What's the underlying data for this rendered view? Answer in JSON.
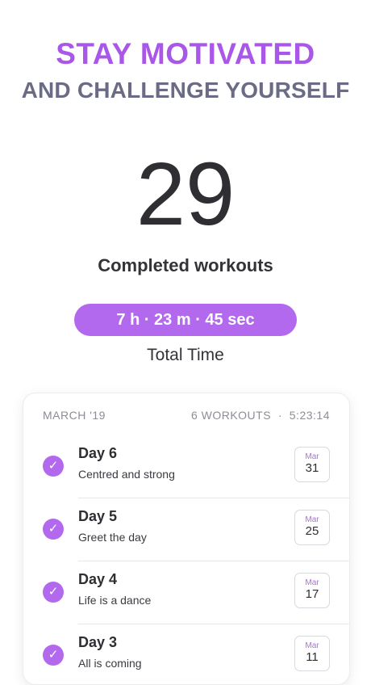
{
  "headline": {
    "line1": "STAY MOTIVATED",
    "line2": "AND CHALLENGE YOURSELF"
  },
  "stats": {
    "count": "29",
    "count_label": "Completed workouts",
    "total_time": "7 h · 23 m · 45 sec",
    "total_time_label": "Total Time"
  },
  "history": {
    "month": "MARCH '19",
    "summary": "6 WORKOUTS  ·  5:23:14",
    "items": [
      {
        "title": "Day 6",
        "subtitle": "Centred and strong",
        "month": "Mar",
        "day": "31"
      },
      {
        "title": "Day 5",
        "subtitle": "Greet the day",
        "month": "Mar",
        "day": "25"
      },
      {
        "title": "Day 4",
        "subtitle": "Life is a dance",
        "month": "Mar",
        "day": "17"
      },
      {
        "title": "Day 3",
        "subtitle": "All is coming",
        "month": "Mar",
        "day": "11"
      }
    ]
  },
  "icons": {
    "check": "checkmark-icon",
    "calendar": "calendar-date-icon"
  },
  "colors": {
    "accent": "#b269ee",
    "headline_primary": "#a957e8",
    "headline_secondary": "#6b6b86"
  }
}
